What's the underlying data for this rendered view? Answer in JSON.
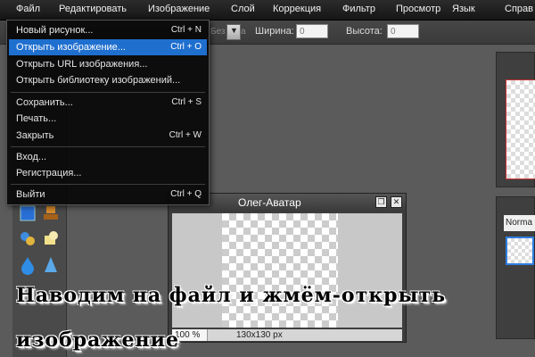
{
  "menubar": {
    "items": [
      "Файл",
      "Редактировать",
      "Изображение",
      "Слой",
      "Коррекция",
      "Фильтр",
      "Просмотр",
      "Язык",
      "Справ"
    ]
  },
  "options_bar": {
    "mode_value": "Без огра",
    "width_label": "Ширина:",
    "width_value": "0",
    "height_label": "Высота:",
    "height_value": "0"
  },
  "file_menu": {
    "items": [
      {
        "label": "Новый рисунок...",
        "shortcut": "Ctrl + N"
      },
      {
        "label": "Открыть изображение...",
        "shortcut": "Ctrl + O",
        "selected": true
      },
      {
        "label": "Открыть URL изображения...",
        "shortcut": ""
      },
      {
        "label": "Открыть библиотеку изображений...",
        "shortcut": ""
      },
      {
        "label": "Сохранить...",
        "shortcut": "Ctrl + S"
      },
      {
        "label": "Печать...",
        "shortcut": ""
      },
      {
        "label": "Закрыть",
        "shortcut": "Ctrl + W"
      },
      {
        "label": "Вход...",
        "shortcut": ""
      },
      {
        "label": "Регистрация...",
        "shortcut": ""
      },
      {
        "label": "Выйти",
        "shortcut": "Ctrl + Q"
      }
    ]
  },
  "image_window": {
    "title": "Олег-Аватар",
    "zoom": "100 %",
    "dimensions": "130x130 px"
  },
  "layers_panel": {
    "blend_mode": "Norma"
  },
  "caption": {
    "line1": "Наводим на файл и жмём-открыть",
    "line2": "изображение"
  },
  "colors": {
    "accent": "#1f6fcf",
    "workspace": "#5b5b5b",
    "menubar": "#1d1d1d"
  },
  "icons": [
    "restore-icon",
    "close-icon",
    "chevron-down-icon",
    "rectangle-tool-icon",
    "stamp-tool-icon",
    "water-drop-icon",
    "sharpen-icon",
    "replace-color-icon",
    "shape-icon"
  ]
}
